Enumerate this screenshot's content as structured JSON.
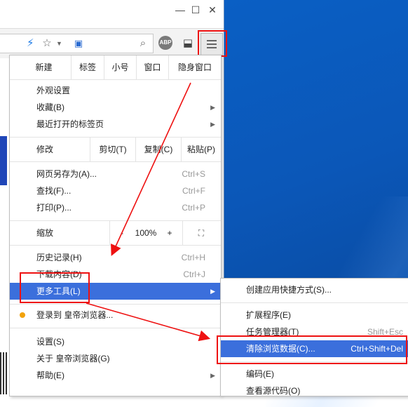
{
  "window": {
    "minimize": "—",
    "maximize": "☐",
    "close": "✕"
  },
  "toolbar": {
    "abp_label": "ABP"
  },
  "menu": {
    "edit_row1": [
      "新建",
      "标签",
      "小号",
      "窗口",
      "隐身窗口"
    ],
    "items_group1": [
      {
        "label": "外观设置",
        "arrow": false
      },
      {
        "label": "收藏(B)",
        "arrow": true
      },
      {
        "label": "最近打开的标签页",
        "arrow": true
      }
    ],
    "edit_row2": {
      "label": "修改",
      "cut": "剪切(T)",
      "copy": "复制(C)",
      "paste": "粘贴(P)"
    },
    "items_group2": [
      {
        "label": "网页另存为(A)...",
        "shortcut": "Ctrl+S"
      },
      {
        "label": "查找(F)...",
        "shortcut": "Ctrl+F"
      },
      {
        "label": "打印(P)...",
        "shortcut": "Ctrl+P"
      }
    ],
    "zoom": {
      "label": "缩放",
      "minus": "-",
      "value": "100%",
      "plus": "+"
    },
    "items_group3": [
      {
        "label": "历史记录(H)",
        "shortcut": "Ctrl+H"
      },
      {
        "label": "下载内容(D)",
        "shortcut": "Ctrl+J"
      },
      {
        "label": "更多工具(L)",
        "shortcut": ""
      }
    ],
    "login": "登录到 皇帝浏览器...",
    "items_group4": [
      {
        "label": "设置(S)",
        "arrow": false
      },
      {
        "label": "关于 皇帝浏览器(G)",
        "arrow": false
      },
      {
        "label": "帮助(E)",
        "arrow": true
      }
    ]
  },
  "submenu": {
    "items": [
      {
        "label": "创建应用快捷方式(S)...",
        "shortcut": ""
      },
      {
        "label": "扩展程序(E)",
        "shortcut": ""
      },
      {
        "label": "任务管理器(T)",
        "shortcut": "Shift+Esc"
      },
      {
        "label": "清除浏览数据(C)...",
        "shortcut": "Ctrl+Shift+Del"
      },
      {
        "label": "编码(E)",
        "shortcut": ""
      },
      {
        "label": "查看源代码(O)",
        "shortcut": ""
      }
    ]
  },
  "colors": {
    "highlight": "#3b6fdc",
    "annotation": "#e11111",
    "desktop": "#0a57b8"
  }
}
